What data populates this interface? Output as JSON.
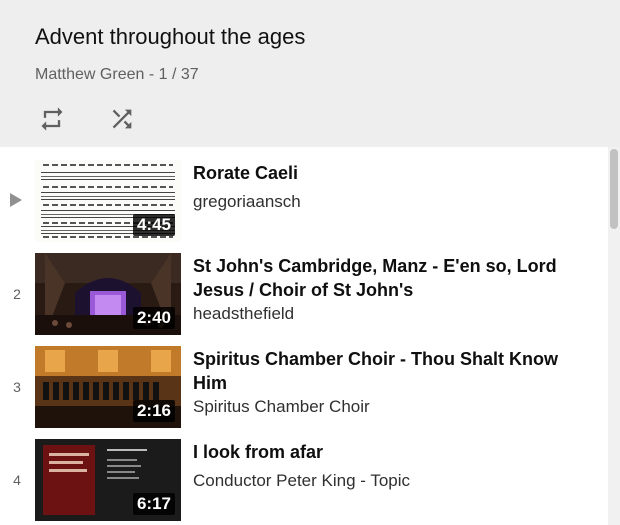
{
  "playlist": {
    "title": "Advent throughout the ages",
    "owner": "Matthew Green",
    "position": "1 / 37",
    "separator": " - "
  },
  "controls": {
    "loop_icon": "loop-icon",
    "shuffle_icon": "shuffle-icon"
  },
  "items": [
    {
      "index": "",
      "now_playing": true,
      "title": "Rorate Caeli",
      "channel": "gregoriaansch",
      "duration": "4:45",
      "thumb": "sheet-music"
    },
    {
      "index": "2",
      "now_playing": false,
      "title": "St John's Cambridge, Manz - E'en so, Lord Jesus / Choir of St John's",
      "channel": "headsthefield",
      "duration": "2:40",
      "thumb": "chapel-interior"
    },
    {
      "index": "3",
      "now_playing": false,
      "title": "Spiritus Chamber Choir - Thou Shalt Know Him",
      "channel": "Spiritus Chamber Choir",
      "duration": "2:16",
      "thumb": "choir-stage"
    },
    {
      "index": "4",
      "now_playing": false,
      "title": "I look from afar",
      "channel": "Conductor Peter King - Topic",
      "duration": "6:17",
      "thumb": "album-cover"
    }
  ],
  "colors": {
    "header_bg": "#eeeeee",
    "list_bg": "#ffffff",
    "text_primary": "#0f0f0f",
    "text_secondary": "#606060"
  }
}
